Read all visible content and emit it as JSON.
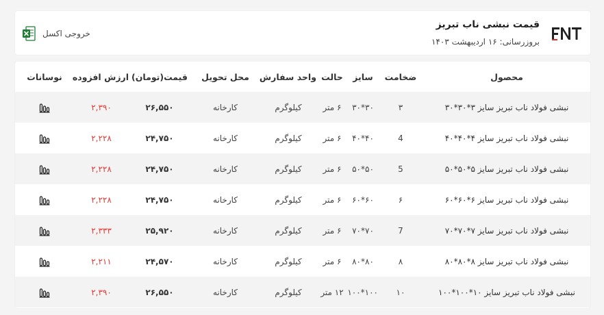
{
  "header": {
    "title": "قیمت نبشی ناب تبریز",
    "updated": "بروزرسانی: ۱۶ اردیبهشت ۱۴۰۳",
    "logo_text": "FNT",
    "export_label": "خروجی اکسل"
  },
  "colors": {
    "vat": "#e53935",
    "excel": "#1e7e34",
    "stripe": "#f3f3f3"
  },
  "table": {
    "columns": [
      "محصول",
      "ضخامت",
      "سایز",
      "حالت",
      "واحد سفارش",
      "محل تحویل",
      "قیمت(تومان)",
      "ارزش افزوده",
      "نوسانات"
    ],
    "rows": [
      {
        "product": "نبشی فولاد ناب تبریز سایز ۳*۳۰*۳۰",
        "thickness": "۳",
        "size": "۳۰*۳۰",
        "state": "۶ متر",
        "unit": "کیلوگرم",
        "delivery": "کارخانه",
        "price": "۲۶,۵۵۰",
        "vat": "۲,۳۹۰"
      },
      {
        "product": "نبشی فولاد ناب تبریز سایز ۴*۴۰*۴۰",
        "thickness": "4",
        "size": "۴۰*۴۰",
        "state": "۶ متر",
        "unit": "کیلوگرم",
        "delivery": "کارخانه",
        "price": "۲۴,۷۵۰",
        "vat": "۲,۲۲۸"
      },
      {
        "product": "نبشی فولاد ناب تبریز سایز ۵*۵۰*۵۰",
        "thickness": "5",
        "size": "۵۰*۵۰",
        "state": "۶ متر",
        "unit": "کیلوگرم",
        "delivery": "کارخانه",
        "price": "۲۴,۷۵۰",
        "vat": "۲,۲۲۸"
      },
      {
        "product": "نبشی فولاد ناب تبریز سایز ۶*۶۰*۶۰",
        "thickness": "۶",
        "size": "۶۰*۶۰",
        "state": "۶ متر",
        "unit": "کیلوگرم",
        "delivery": "کارخانه",
        "price": "۲۴,۷۵۰",
        "vat": "۲,۲۲۸"
      },
      {
        "product": "نبشی فولاد ناب تبریز سایز ۷*۷۰*۷۰",
        "thickness": "7",
        "size": "۷۰*۷۰",
        "state": "۶ متر",
        "unit": "کیلوگرم",
        "delivery": "کارخانه",
        "price": "۲۵,۹۲۰",
        "vat": "۲,۳۳۳"
      },
      {
        "product": "نبشی فولاد ناب تبریز سایز ۸*۸۰*۸۰",
        "thickness": "۸",
        "size": "۸۰*۸۰",
        "state": "۶ متر",
        "unit": "کیلوگرم",
        "delivery": "کارخانه",
        "price": "۲۴,۵۷۰",
        "vat": "۲,۲۱۱"
      },
      {
        "product": "نبشی فولاد ناب تبریز سایز ۱۰*۱۰۰*۱۰۰",
        "thickness": "۱۰",
        "size": "۱۰۰*۱۰۰",
        "state": "۱۲ متر",
        "unit": "کیلوگرم",
        "delivery": "کارخانه",
        "price": "۲۶,۵۵۰",
        "vat": "۲,۳۹۰"
      }
    ]
  }
}
